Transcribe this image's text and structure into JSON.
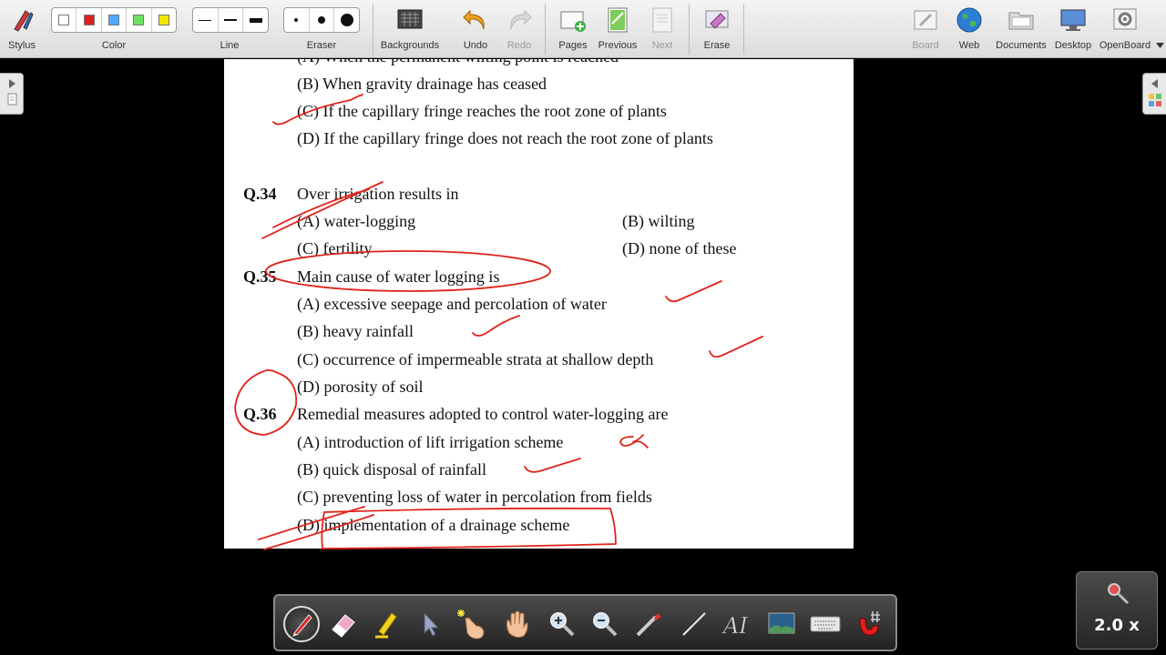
{
  "toolbar": {
    "stylus": "Stylus",
    "color": "Color",
    "line": "Line",
    "eraser": "Eraser",
    "backgrounds": "Backgrounds",
    "undo": "Undo",
    "redo": "Redo",
    "pages": "Pages",
    "previous": "Previous",
    "next": "Next",
    "erase": "Erase",
    "board": "Board",
    "web": "Web",
    "documents": "Documents",
    "desktop": "Desktop",
    "openboard": "OpenBoard",
    "colors": [
      "#ffffff",
      "#e02020",
      "#4fa8ff",
      "#6ee060",
      "#f5e600"
    ]
  },
  "document": {
    "q33": {
      "a": "(A)  When the permanent wilting point is reached",
      "b": "(B)  When gravity drainage has ceased",
      "c": "(C)  If the capillary fringe reaches the root zone of plants",
      "d": "(D)  If the capillary fringe does not reach the root zone of plants"
    },
    "q34": {
      "num": "Q.34",
      "text": "Over irrigation results in",
      "a": "(A) water-logging",
      "b": "(B)  wilting",
      "c": "(C)  fertility",
      "d": "(D)  none of these"
    },
    "q35": {
      "num": "Q.35",
      "text": "Main cause of water logging is",
      "a": "(A)  excessive seepage and percolation of water",
      "b": "(B)  heavy rainfall",
      "c": "(C)  occurrence of impermeable strata at shallow depth",
      "d": "(D) porosity of soil"
    },
    "q36": {
      "num": "Q.36",
      "text": "Remedial measures adopted to control water-logging are",
      "a": "(A)  introduction of lift irrigation scheme",
      "b": "(B)  quick disposal of rainfall",
      "c": "(C)  preventing loss of water in percolation from fields",
      "d": "(D)  implementation of a drainage scheme"
    }
  },
  "ink_color": "#e0241b",
  "zoom": {
    "level": "2.0 x"
  }
}
